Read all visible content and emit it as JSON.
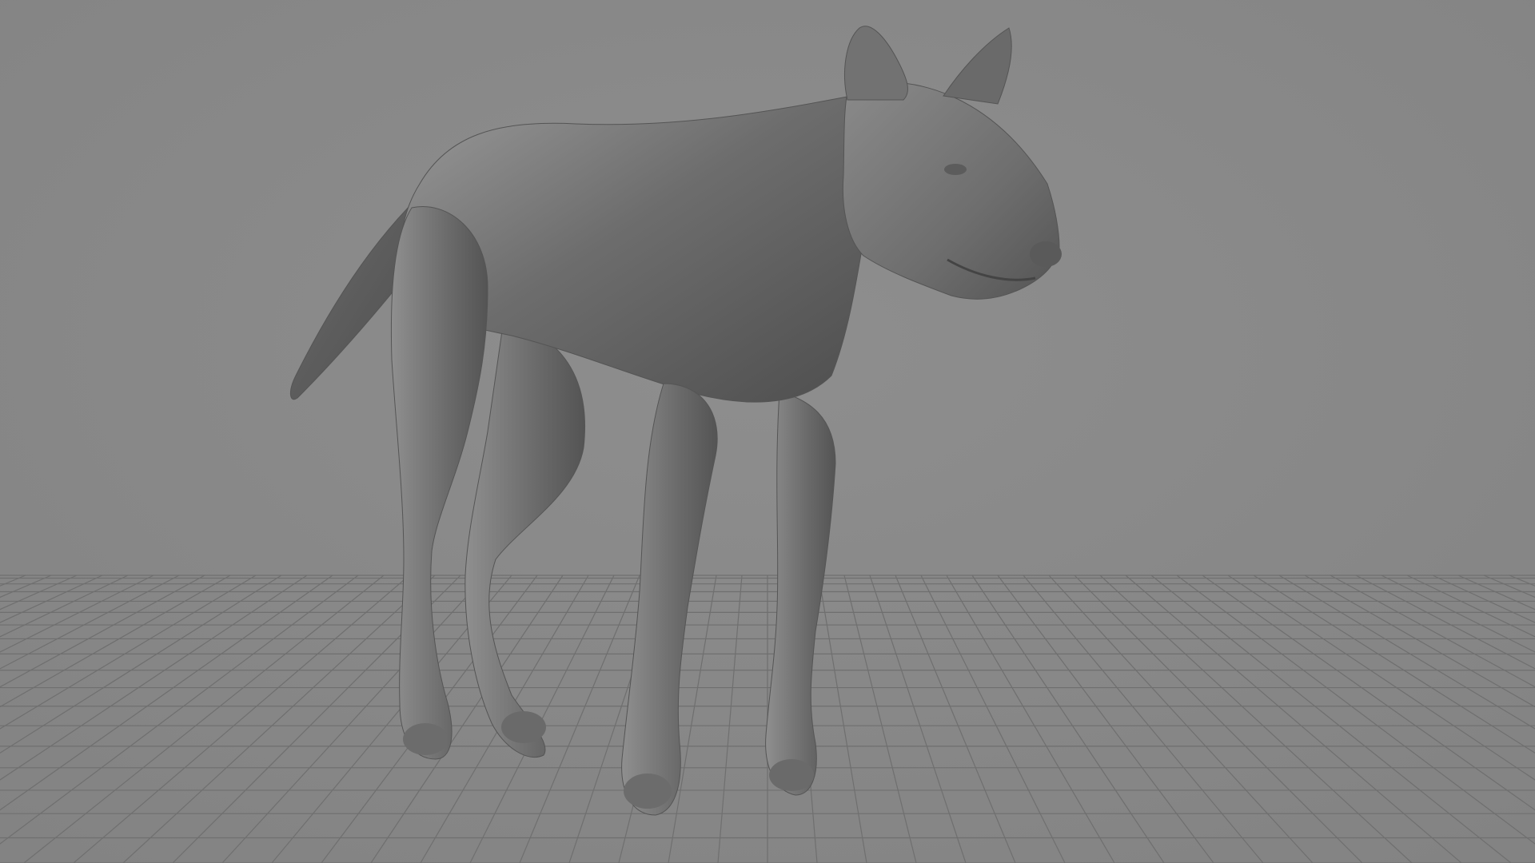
{
  "viewport": {
    "background_color": "#8a8a8a",
    "grid_color": "#6e6e6e",
    "model_color": "#7a7a7a",
    "model_shadow_color": "#4a4a4a",
    "model_highlight_color": "#a8a8a8",
    "object": "wolf-model"
  }
}
